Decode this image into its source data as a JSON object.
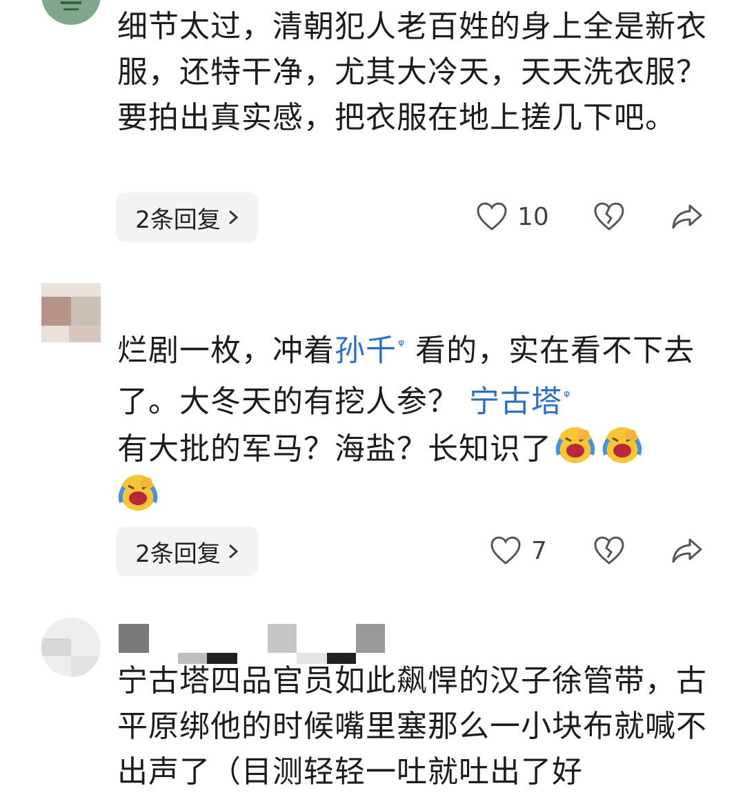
{
  "comments": [
    {
      "text": "细节太过，清朝犯人老百姓的身上全是新衣服，还特干净，尤其大冷天，天天洗衣服？要拍出真实感，把衣服在地上搓几下吧。",
      "reply_label": "2条回复",
      "like_count": "10"
    },
    {
      "text_a": "烂剧一枚，冲着",
      "link_1": "孙千",
      "text_b": "看的，实在看不下去了。大冬天的有挖人参？",
      "link_2": "宁古塔",
      "text_c": "有大批的军马？海盐？长知识了",
      "reply_label": "2条回复",
      "like_count": "7"
    },
    {
      "text": "宁古塔四品官员如此飙悍的汉子徐管带，古平原绑他的时候嘴里塞那么一小块布就喊不出声了（目测轻轻一吐就吐出了好"
    }
  ],
  "icons": {
    "like": "heart-outline-icon",
    "dislike": "broken-heart-icon",
    "share": "share-arrow-icon",
    "emoji": "laughing-crying-emoji"
  },
  "colors": {
    "link": "#2a6fc9",
    "reply_bg": "#f3f3f3",
    "icon": "#555555"
  }
}
